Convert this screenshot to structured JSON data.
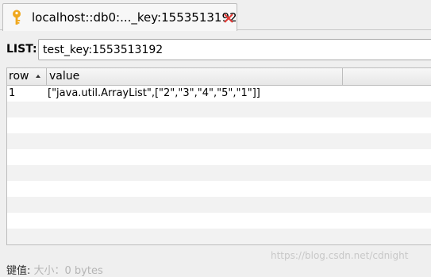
{
  "tab": {
    "title": "localhost::db0:..._key:1553513192",
    "icon": "key-icon",
    "close_icon": "close-icon",
    "icon_color": "#f0a81e",
    "close_color": "#e53935"
  },
  "key_row": {
    "label": "LIST:",
    "value": "test_key:1553513192"
  },
  "table": {
    "columns": [
      "row",
      "value",
      ""
    ],
    "rows": [
      {
        "row": "1",
        "value": "[\"java.util.ArrayList\",[\"2\",\"3\",\"4\",\"5\",\"1\"]]"
      }
    ],
    "empty_rows": 9
  },
  "status": {
    "key_label": "键值:",
    "size_text": "大小：0 bytes"
  },
  "watermark": "https://blog.csdn.net/cdnight"
}
